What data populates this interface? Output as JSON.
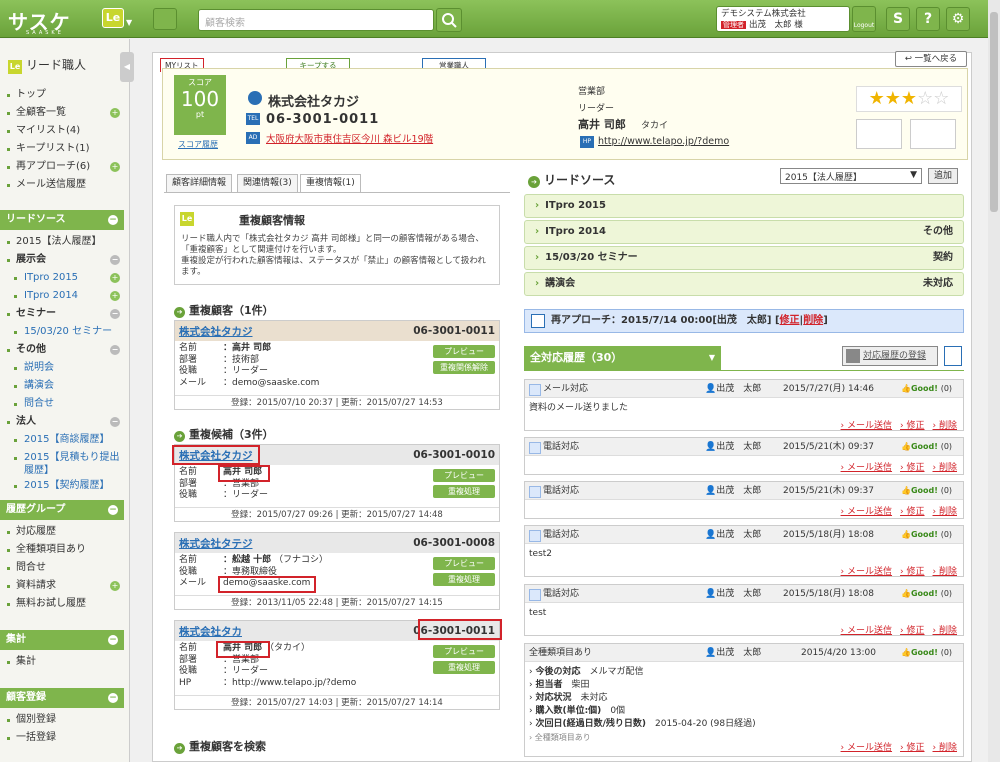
{
  "header": {
    "logo": "サスケ",
    "logo_sub": "SAASKE",
    "product_badge": "Le",
    "search_placeholder": "顧客検索",
    "company": "デモシステム株式会社",
    "admin_tag": "管理者",
    "user": "出茂　太郎 様",
    "logout": "Logout",
    "help": "?"
  },
  "sidebar": {
    "title": "リード職人",
    "nav": [
      "トップ",
      "全顧客一覧",
      "マイリスト(4)",
      "キープリスト(1)",
      "再アプローチ(6)",
      "メール送信履歴"
    ],
    "lead_head": "リードソース",
    "lead_items": [
      "2015【法人履歴】",
      "展示会",
      "ITpro 2015",
      "ITpro 2014",
      "セミナー",
      "15/03/20 セミナー",
      "その他",
      "説明会",
      "講演会",
      "問合せ",
      "法人",
      "2015【商談履歴】",
      "2015【見積もり提出履歴】",
      "2015【契約履歴】"
    ],
    "history_head": "履歴グループ",
    "history_items": [
      "対応履歴",
      "全種類項目あり",
      "問合せ",
      "資料請求",
      "無料お試し履歴"
    ],
    "summary_head": "集計",
    "summary_items": [
      "集計"
    ],
    "register_head": "顧客登録",
    "register_items": [
      "個別登録",
      "一括登録"
    ]
  },
  "top_tabs": {
    "mylist": "MYリスト",
    "keep": "キープする",
    "sales": "営業職人",
    "back": "一覧へ戻る"
  },
  "company": {
    "score_label": "スコア",
    "score": "100",
    "score_unit": "pt",
    "score_link": "スコア履歴",
    "name": "株式会社タカジ",
    "tel_tag": "TEL",
    "tel": "06-3001-0011",
    "ad_tag": "AD",
    "address": "大阪府大阪市東住吉区今川 森ビル19階",
    "dept": "営業部",
    "role": "リーダー",
    "person": "高井 司郎",
    "kana": "タカイ",
    "hp_tag": "HP",
    "url": "http://www.telapo.jp/?demo",
    "rating": 3
  },
  "sub_tabs": [
    "顧客詳細情報",
    "関連情報(3)",
    "重複情報(1)"
  ],
  "dup_info": {
    "title": "重複顧客情報",
    "desc1": "リード職人内で「株式会社タカジ 高井 司郎様」と同一の顧客情報がある場合、",
    "desc2": "「重複顧客」として関連付けを行います。",
    "desc3": "重複設定が行われた顧客情報は、ステータスが「禁止」の顧客情報として扱われます。"
  },
  "dup_section": "重複顧客（1件）",
  "cand_section": "重複候補（3件）",
  "search_section": "重複顧客を検索",
  "labels": {
    "name": "名前",
    "dept": "部署",
    "role": "役職",
    "mail": "メール",
    "hp": "HP",
    "preview": "プレビュー",
    "unlink": "重複関係解除",
    "process": "重複処理"
  },
  "dup_card": {
    "company": "株式会社タカジ",
    "tel": "06-3001-0011",
    "name": "：高井 司郎",
    "dept": "：技術部",
    "role": "：リーダー",
    "mail": "：demo@saaske.com",
    "footer": "登録：2015/07/10 20:37 | 更新：2015/07/27 14:53"
  },
  "cand1": {
    "company": "株式会社タカジ",
    "tel": "06-3001-0010",
    "name": "高井 司郎",
    "dept": "：営業部",
    "role": "：リーダー",
    "footer": "登録：2015/07/27 09:26 | 更新：2015/07/27 14:48"
  },
  "cand2": {
    "company": "株式会社タテジ",
    "tel": "06-3001-0008",
    "name": "：舩越 十郎",
    "kana": "（フナコシ）",
    "role": "：専務取締役",
    "mail": "demo@saaske.com",
    "footer": "登録：2013/11/05 22:48 | 更新：2015/07/27 14:15"
  },
  "cand3": {
    "company": "株式会社タカ",
    "tel": "06-3001-0011",
    "name": "高井 司郎",
    "kana": "（タカイ）",
    "dept": "：営業部",
    "role": "：リーダー",
    "hp": "：http://www.telapo.jp/?demo",
    "footer": "登録：2015/07/27 14:03 | 更新：2015/07/27 14:14"
  },
  "lead": {
    "title": "リードソース",
    "select": "2015【法人履歴】",
    "add": "追加",
    "rows": [
      {
        "name": "ITpro 2015",
        "status": ""
      },
      {
        "name": "ITpro 2014",
        "status": "その他"
      },
      {
        "name": "15/03/20 セミナー",
        "status": "契約"
      },
      {
        "name": "講演会",
        "status": "未対応"
      }
    ]
  },
  "reapproach": {
    "text": "再アプローチ：2015/7/14 00:00[出茂　太郎]",
    "edit": "修正",
    "delete": "削除"
  },
  "history": {
    "tab": "全対応履歴（30）",
    "register": "対応履歴の登録",
    "mail_send": "メール送信",
    "edit": "修正",
    "delete": "削除",
    "good": "Good!",
    "items": [
      {
        "type": "メール対応",
        "who": "出茂　太郎",
        "when": "2015/7/27(月) 14:46",
        "count": "(0)",
        "body": "資料のメール送りました"
      },
      {
        "type": "電話対応",
        "who": "出茂　太郎",
        "when": "2015/5/21(木) 09:37",
        "count": "(0)",
        "body": ""
      },
      {
        "type": "電話対応",
        "who": "出茂　太郎",
        "when": "2015/5/21(木) 09:37",
        "count": "(0)",
        "body": ""
      },
      {
        "type": "電話対応",
        "who": "出茂　太郎",
        "when": "2015/5/18(月) 18:08",
        "count": "(0)",
        "body": "test2"
      },
      {
        "type": "電話対応",
        "who": "出茂　太郎",
        "when": "2015/5/18(月) 18:08",
        "count": "(0)",
        "body": "test"
      },
      {
        "type": "全種類項目あり",
        "who": "出茂　太郎",
        "when": "2015/4/20 13:00",
        "count": "(0)",
        "body": ""
      }
    ],
    "detail": [
      {
        "k": "今後の対応",
        "v": "メルマガ配信"
      },
      {
        "k": "担当者",
        "v": "柴田"
      },
      {
        "k": "対応状況",
        "v": "未対応"
      },
      {
        "k": "購入数(単位:個)",
        "v": "0個"
      },
      {
        "k": "次回日(経過日数/残り日数)",
        "v": "2015-04-20 (98日経過)"
      }
    ],
    "detail_foot": "全種類項目あり"
  }
}
